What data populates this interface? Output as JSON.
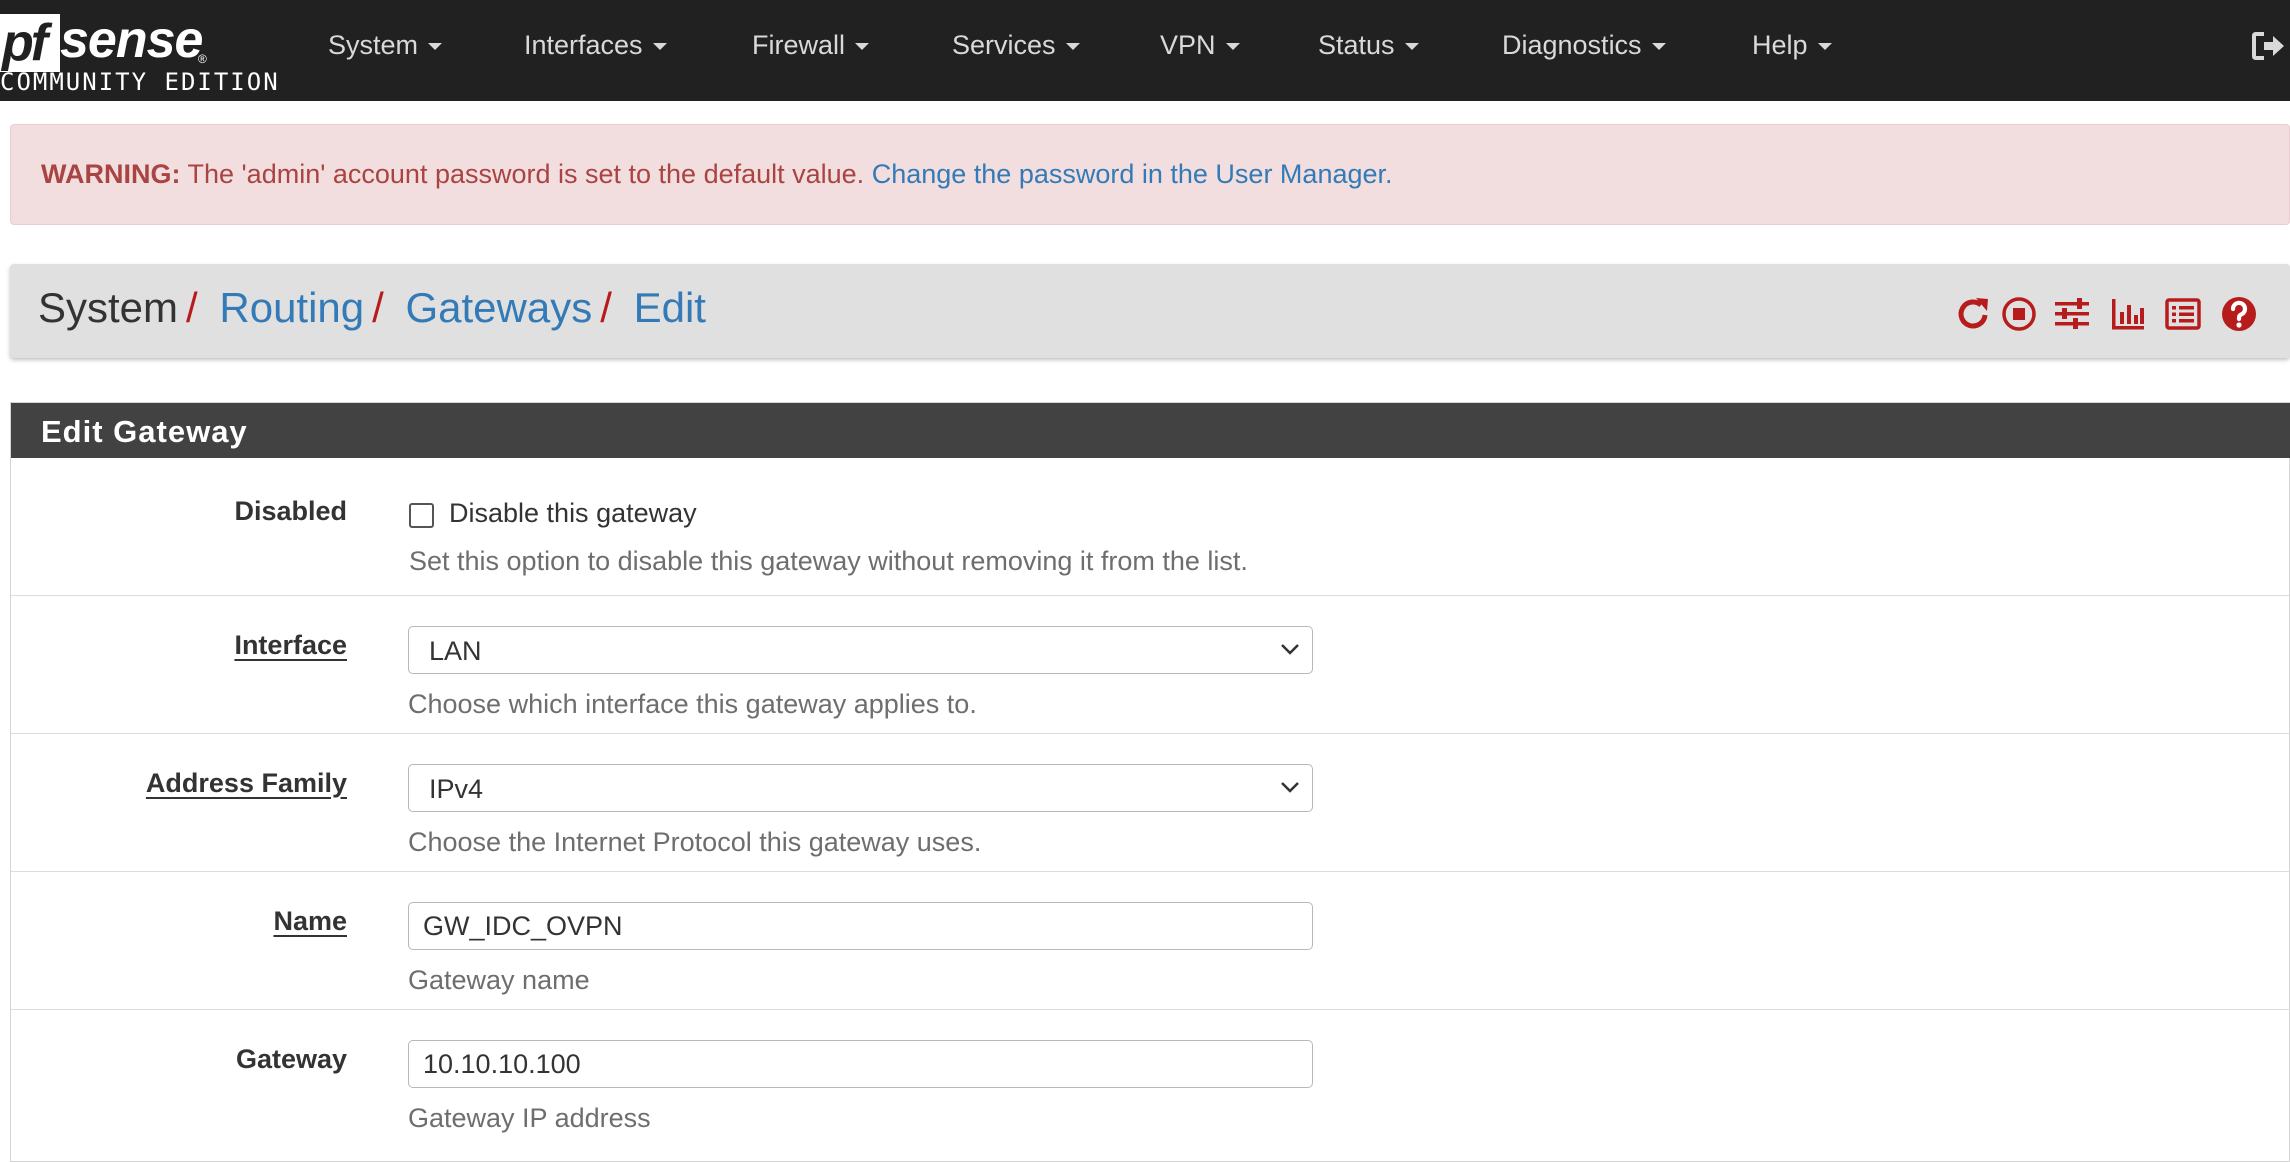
{
  "brand": {
    "logo_pf": "pf",
    "logo_sense": "sense",
    "logo_mark": "®",
    "edition": "COMMUNITY EDITION"
  },
  "nav": {
    "items": [
      {
        "label": "System"
      },
      {
        "label": "Interfaces"
      },
      {
        "label": "Firewall"
      },
      {
        "label": "Services"
      },
      {
        "label": "VPN"
      },
      {
        "label": "Status"
      },
      {
        "label": "Diagnostics"
      },
      {
        "label": "Help"
      }
    ],
    "logout_icon": "sign-out-icon"
  },
  "alert": {
    "prefix": "WARNING:",
    "message": "The 'admin' account password is set to the default value.",
    "link_text": "Change the password in the User Manager."
  },
  "breadcrumb": {
    "items": [
      "System",
      "Routing",
      "Gateways",
      "Edit"
    ],
    "separator": "/"
  },
  "toolbar": {
    "icons": [
      "refresh-icon",
      "stop-circle-icon",
      "sliders-icon",
      "bar-chart-icon",
      "list-icon",
      "help-circle-icon"
    ],
    "color": "#b71c1c"
  },
  "panel": {
    "title": "Edit Gateway",
    "fields": {
      "disabled": {
        "label": "Disabled",
        "checkbox_label": "Disable this gateway",
        "checked": false,
        "help": "Set this option to disable this gateway without removing it from the list."
      },
      "interface": {
        "label": "Interface",
        "value": "LAN",
        "help": "Choose which interface this gateway applies to."
      },
      "address_family": {
        "label": "Address Family",
        "value": "IPv4",
        "help": "Choose the Internet Protocol this gateway uses."
      },
      "name": {
        "label": "Name",
        "value": "GW_IDC_OVPN",
        "help": "Gateway name"
      },
      "gateway": {
        "label": "Gateway",
        "value": "10.10.10.100",
        "help": "Gateway IP address"
      }
    }
  },
  "colors": {
    "navbar": "#212121",
    "panel_heading": "#424242",
    "alert_bg": "#f2dede",
    "alert_text": "#a94442",
    "link": "#337ab7",
    "accent_red": "#b71c1c"
  }
}
